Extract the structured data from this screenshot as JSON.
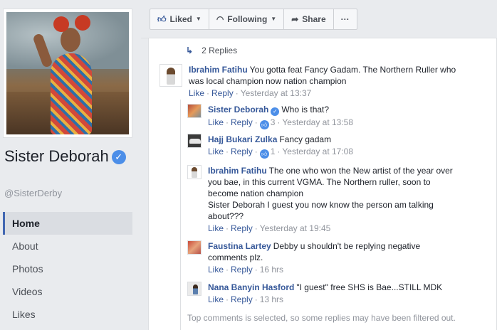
{
  "page": {
    "name": "Sister Deborah",
    "handle": "@SisterDerby"
  },
  "nav": [
    {
      "label": "Home",
      "active": true
    },
    {
      "label": "About"
    },
    {
      "label": "Photos"
    },
    {
      "label": "Videos"
    },
    {
      "label": "Likes"
    }
  ],
  "actions": {
    "liked": "Liked",
    "following": "Following",
    "share": "Share",
    "more": "···"
  },
  "thread": {
    "replies_label": "2 Replies",
    "footer_note": "Top comments is selected, so some replies may have been filtered out."
  },
  "comments": {
    "c1": {
      "author": "Ibrahim Fatihu",
      "text": "You gotta feat Fancy Gadam. The Northern Ruller who was local champion now nation champion",
      "like": "Like",
      "reply": "Reply",
      "time": "Yesterday at 13:37"
    },
    "c2": {
      "author": "Sister Deborah",
      "text": "Who is that?",
      "like": "Like",
      "reply": "Reply",
      "reactions": "3",
      "time": "Yesterday at 13:58"
    },
    "c3": {
      "author": "Hajj Bukari Zulka",
      "text": "Fancy gadam",
      "like": "Like",
      "reply": "Reply",
      "reactions": "1",
      "time": "Yesterday at 17:08"
    },
    "c4": {
      "author": "Ibrahim Fatihu",
      "text": "The one who won the New artist of the year over you bae, in this current VGMA. The Northern ruller, soon to become nation champion",
      "text2": "Sister Deborah I guest you now know the person am talking about???",
      "like": "Like",
      "reply": "Reply",
      "time": "Yesterday at 19:45"
    },
    "c5": {
      "author": "Faustina Lartey",
      "text": "Debby u shouldn't be replying negative comments plz.",
      "like": "Like",
      "reply": "Reply",
      "time": "16 hrs"
    },
    "c6": {
      "author": "Nana Banyin Hasford",
      "text": "\"I guest\" free SHS is Bae...STILL MDK",
      "like": "Like",
      "reply": "Reply",
      "time": "13 hrs"
    }
  },
  "colors": {
    "link": "#365899",
    "meta": "#90949c",
    "verified": "#4c8ee8",
    "background": "#e9ebee"
  }
}
